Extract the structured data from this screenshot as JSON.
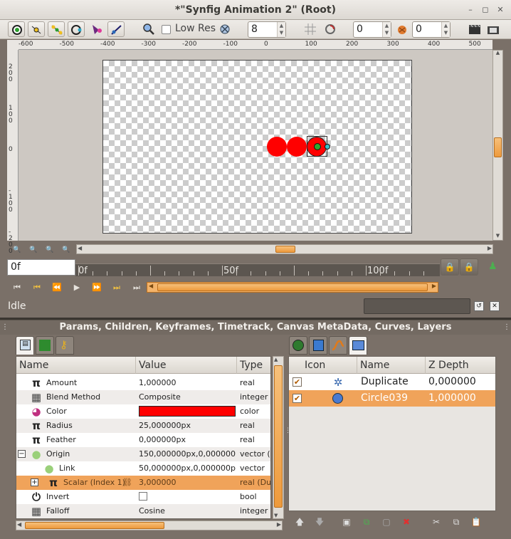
{
  "window": {
    "title": "*\"Synfig Animation 2\" (Root)",
    "controls": [
      "minimize-icon",
      "maximize-icon",
      "close-icon"
    ]
  },
  "toolbar": {
    "low_res_label": "Low Res",
    "low_res_checked": false,
    "resolution_value": "8",
    "past_onion_value": "0",
    "future_onion_value": "0"
  },
  "ruler": {
    "horizontal_ticks": [
      "-600",
      "-500",
      "-400",
      "-300",
      "-200",
      "-100",
      "0",
      "100",
      "200",
      "300",
      "400",
      "500"
    ],
    "vertical_ticks": [
      "2\n0\n0",
      "1\n0\n0",
      "0",
      "-\n1\n0\n0",
      "-\n2\n0\n0"
    ]
  },
  "timebar": {
    "current_frame": "0f",
    "labels": [
      "0f",
      "50f",
      "100f"
    ]
  },
  "status": {
    "text": "Idle"
  },
  "panel": {
    "title": "Params, Children, Keyframes, Timetrack, Canvas MetaData, Curves, Layers",
    "params_headers": {
      "name": "Name",
      "value": "Value",
      "type": "Type"
    },
    "params": [
      {
        "name": "Amount",
        "value": "1,000000",
        "type": "real",
        "icon": "pi-icon"
      },
      {
        "name": "Blend Method",
        "value": "Composite",
        "type": "integer",
        "icon": "blend-method-icon"
      },
      {
        "name": "Color",
        "value": "",
        "type": "color",
        "icon": "color-wheel-icon",
        "swatch": "#ff0000"
      },
      {
        "name": "Radius",
        "value": "25,000000px",
        "type": "real",
        "icon": "pi-icon"
      },
      {
        "name": "Feather",
        "value": "0,000000px",
        "type": "real",
        "icon": "pi-icon"
      },
      {
        "name": "Origin",
        "value": "150,000000px,0,000000px",
        "type": "vector (S",
        "icon": "origin-circle-icon",
        "expander": "−"
      },
      {
        "name": "Link",
        "value": "50,000000px,0,000000px",
        "type": "vector",
        "icon": "origin-circle-icon"
      },
      {
        "name": "Scalar (Index 1)",
        "value": "3,000000",
        "type": "real (Du",
        "icon": "pi-icon",
        "expander": "+"
      },
      {
        "name": "Invert",
        "value": "",
        "type": "bool",
        "icon": "power-icon",
        "checkbox": false
      },
      {
        "name": "Falloff",
        "value": "Cosine",
        "type": "integer",
        "icon": "blend-method-icon"
      }
    ],
    "layers_headers": {
      "icon": "Icon",
      "name": "Name",
      "zdepth": "Z Depth"
    },
    "layers": [
      {
        "checked": true,
        "icon": "duplicate-layer-icon",
        "name": "Duplicate",
        "zdepth": "0,000000"
      },
      {
        "checked": true,
        "icon": "circle-layer-icon",
        "name": "Circle039",
        "zdepth": "1,000000"
      }
    ]
  },
  "colors": {
    "accent_orange": "#f0a35a",
    "circle_red": "#ff0000",
    "window_brown": "#7a7068"
  }
}
